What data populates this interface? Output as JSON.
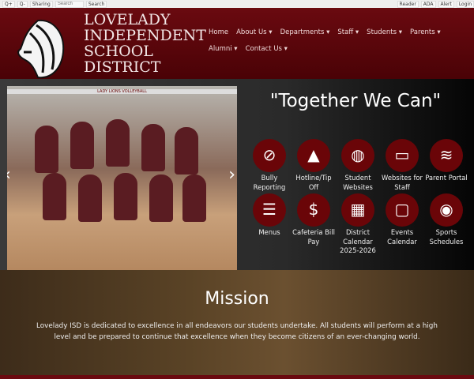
{
  "toolbar": {
    "sharing": "Sharing",
    "search_placeholder": "Search",
    "search_button": "Search",
    "reader": "Reader",
    "ada": "ADA",
    "alert": "Alert",
    "login": "Login"
  },
  "header": {
    "title_lines": [
      "LOVELADY",
      "INDEPENDENT",
      "SCHOOL",
      "DISTRICT"
    ]
  },
  "nav": [
    "Home",
    "About Us ▾",
    "Departments ▾",
    "Staff ▾",
    "Students ▾",
    "Parents ▾",
    "Alumni ▾",
    "Contact Us ▾"
  ],
  "hero": {
    "slogan": "\"Together We Can\"",
    "banner": "LADY LIONS VOLLEYBALL"
  },
  "quicklinks": [
    {
      "icon": "ban-icon",
      "glyph": "⊘",
      "label": "Bully Reporting"
    },
    {
      "icon": "warning-icon",
      "glyph": "▲",
      "label": "Hotline/Tip Off"
    },
    {
      "icon": "globe-icon",
      "glyph": "◍",
      "label": "Student Websites"
    },
    {
      "icon": "monitor-icon",
      "glyph": "▭",
      "label": "Websites for Staff"
    },
    {
      "icon": "layers-icon",
      "glyph": "≋",
      "label": "Parent Portal"
    },
    {
      "icon": "burger-icon",
      "glyph": "☰",
      "label": "Menus"
    },
    {
      "icon": "money-icon",
      "glyph": "$",
      "label": "Cafeteria Bill Pay"
    },
    {
      "icon": "calendar-icon",
      "glyph": "▦",
      "label": "District Calendar 2025-2026"
    },
    {
      "icon": "ticket-icon",
      "glyph": "▢",
      "label": "Events Calendar"
    },
    {
      "icon": "basketball-icon",
      "glyph": "◉",
      "label": "Sports Schedules"
    }
  ],
  "mission": {
    "title": "Mission",
    "text": "Lovelady ISD is dedicated to excellence in all endeavors our students undertake. All students will perform at a high level and be prepared to continue that excellence when they become citizens of an ever-changing world."
  }
}
